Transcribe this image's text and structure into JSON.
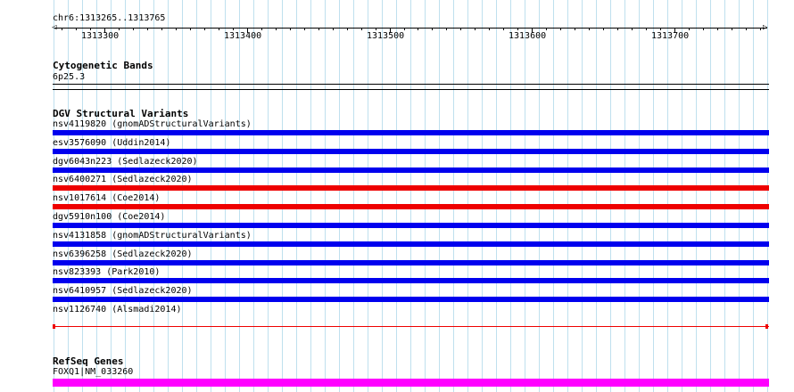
{
  "grid_color": "#bfe0ee",
  "ruler": {
    "location": "chr6:1313265..1313765",
    "start": 1313265,
    "end": 1313765,
    "major_ticks": [
      "1313300",
      "1313400",
      "1313500",
      "1313600",
      "1313700"
    ],
    "left_arrow": "◁",
    "right_arrow": "▷"
  },
  "cytobands": {
    "title": "Cytogenetic Bands",
    "band": "6p25.3"
  },
  "dgv": {
    "title": "DGV Structural Variants",
    "colors": {
      "gain": "#0000ee",
      "loss": "#ee0000"
    },
    "features": [
      {
        "label": "nsv4119820 (gnomADStructuralVariants)",
        "type": "gain"
      },
      {
        "label": "esv3576090 (Uddin2014)",
        "type": "gain"
      },
      {
        "label": "dgv6043n223 (Sedlazeck2020)",
        "type": "gain"
      },
      {
        "label": "nsv6400271 (Sedlazeck2020)",
        "type": "loss"
      },
      {
        "label": "nsv1017614 (Coe2014)",
        "type": "loss"
      },
      {
        "label": "dgv5910n100 (Coe2014)",
        "type": "gain"
      },
      {
        "label": "nsv4131858 (gnomADStructuralVariants)",
        "type": "gain"
      },
      {
        "label": "nsv6396258 (Sedlazeck2020)",
        "type": "gain"
      },
      {
        "label": "nsv823393 (Park2010)",
        "type": "gain"
      },
      {
        "label": "nsv6410957 (Sedlazeck2020)",
        "type": "gain"
      },
      {
        "label": "nsv1126740 (Alsmadi2014)",
        "type": "loss_thin"
      }
    ]
  },
  "refseq": {
    "title": "RefSeq Genes",
    "gene": "FOXQ1|NM_033260",
    "color": "#ff00ff"
  }
}
